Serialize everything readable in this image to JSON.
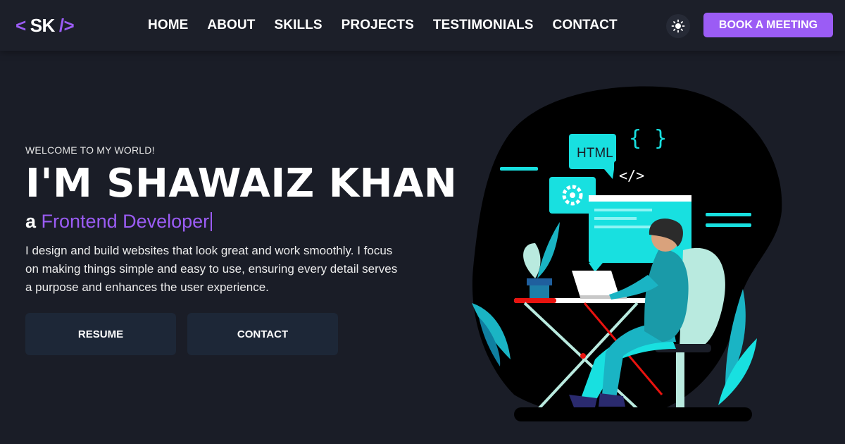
{
  "nav": {
    "logo": {
      "left": "<",
      "text": "SK",
      "right": "/>"
    },
    "links": [
      "HOME",
      "ABOUT",
      "SKILLS",
      "PROJECTS",
      "TESTIMONIALS",
      "CONTACT"
    ],
    "theme_icon": "sun-icon",
    "cta_label": "BOOK A MEETING"
  },
  "hero": {
    "welcome": "WELCOME TO MY WORLD!",
    "name": "I'M SHAWAIZ KHAN",
    "role_prefix": "a ",
    "role": "Frontend Developer",
    "bio": "I design and build websites that look great and work smoothly. I focus on making things simple and easy to use, ensuring every detail serves a purpose and enhances the user experience.",
    "buttons": {
      "resume": "RESUME",
      "contact": "CONTACT"
    }
  },
  "illustration": {
    "html_tag": "HTML",
    "code_tag": "</>",
    "braces": "{ }"
  },
  "colors": {
    "background": "#1a1d27",
    "accent": "#9b5cf5",
    "button_bg": "#1d2737",
    "illustration_cyan": "#18e0e0",
    "illustration_dark": "#000000"
  }
}
